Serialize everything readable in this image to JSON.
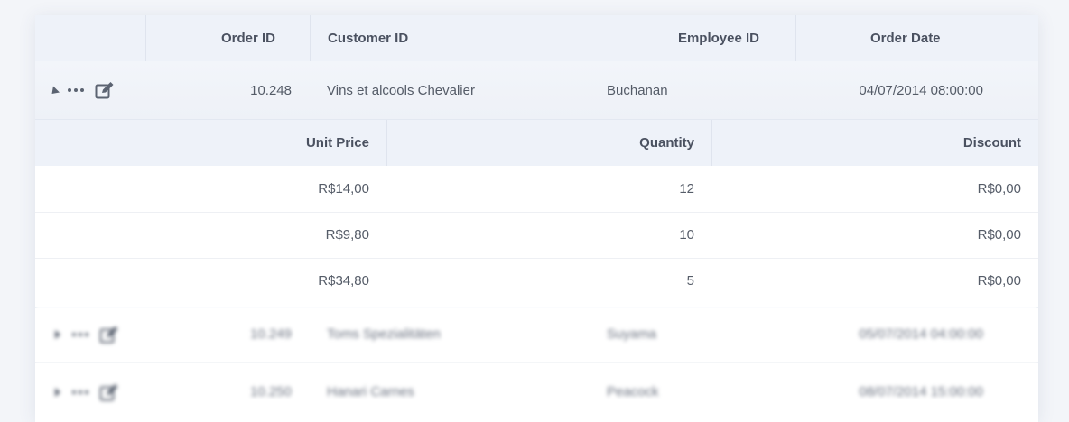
{
  "columns": {
    "order_id": "Order ID",
    "customer_id": "Customer ID",
    "employee_id": "Employee ID",
    "order_date": "Order Date"
  },
  "expanded_order": {
    "order_id": "10.248",
    "customer": "Vins et alcools Chevalier",
    "employee": "Buchanan",
    "date": "04/07/2014 08:00:00"
  },
  "detail_columns": {
    "unit_price": "Unit Price",
    "quantity": "Quantity",
    "discount": "Discount"
  },
  "detail_rows": [
    {
      "unit_price": "R$14,00",
      "quantity": "12",
      "discount": "R$0,00"
    },
    {
      "unit_price": "R$9,80",
      "quantity": "10",
      "discount": "R$0,00"
    },
    {
      "unit_price": "R$34,80",
      "quantity": "5",
      "discount": "R$0,00"
    }
  ],
  "collapsed_orders": [
    {
      "order_id": "10.249",
      "customer": "Toms Spezialitäten",
      "employee": "Suyama",
      "date": "05/07/2014 04:00:00"
    },
    {
      "order_id": "10.250",
      "customer": "Hanari Carnes",
      "employee": "Peacock",
      "date": "08/07/2014 15:00:00"
    }
  ],
  "icons": {
    "expanded": "caret-down-icon",
    "collapsed": "caret-right-icon",
    "more": "more-dots-icon",
    "edit": "edit-icon"
  }
}
